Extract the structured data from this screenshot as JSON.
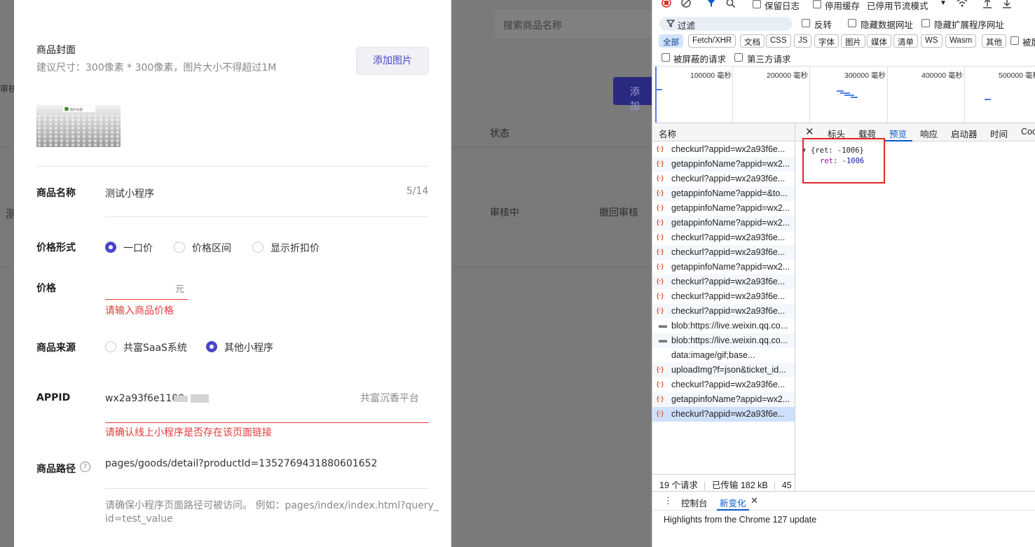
{
  "background_page": {
    "search_placeholder": "搜索商品名称",
    "left_fragment": "审核中",
    "add_button_label": "添加",
    "column_status": "状态",
    "row_fragment": "测",
    "row_status": "审核中",
    "row_action": "撤回审核"
  },
  "form": {
    "cover_label": "商品封面",
    "cover_hint": "建议尺寸：300像素 * 300像素，图片大小不得超过1M",
    "add_image_label": "添加图片",
    "cover_image_caption": "图片标题",
    "name_label": "商品名称",
    "name_value": "测试小程序",
    "name_counter": "5/14",
    "price_type_label": "价格形式",
    "price_type_options": [
      "一口价",
      "价格区间",
      "显示折扣价"
    ],
    "price_type_selected": "一口价",
    "price_label": "价格",
    "price_unit": "元",
    "price_error": "请输入商品价格",
    "source_label": "商品来源",
    "source_options": [
      "共富SaaS系统",
      "其他小程序"
    ],
    "source_selected": "其他小程序",
    "appid_label": "APPID",
    "appid_value": "wx2a93f6e1100",
    "appid_platform": "共富沉香平台",
    "appid_error": "请确认线上小程序是否存在该页面链接",
    "path_label": "商品路径",
    "path_help_icon": "?",
    "path_value": "pages/goods/detail?productId=1352769431880601652",
    "path_hint_line1": "请确保小程序页面路径可被访问。 例如：pages/index/index.html?query_",
    "path_hint_line2": "id=test_value"
  },
  "devtools": {
    "toolbar": {
      "preserve_log": "保留日志",
      "disable_cache": "停用缓存",
      "throttle": "已停用节流模式"
    },
    "filter": {
      "placeholder": "过滤",
      "invert": "反转",
      "hide_data_urls": "隐藏数据网址",
      "hide_extension_urls": "隐藏扩展程序网址",
      "blocked_requests": "被屏蔽的请求",
      "third_party": "第三方请求",
      "blocked_cookies_fragment": "被屏"
    },
    "type_chips": [
      "全部",
      "Fetch/XHR",
      "文档",
      "CSS",
      "JS",
      "字体",
      "图片",
      "媒体",
      "清单",
      "WS",
      "Wasm",
      "其他"
    ],
    "selected_chip": "全部",
    "timeline_labels": [
      "100000 毫秒",
      "200000 毫秒",
      "300000 毫秒",
      "400000 毫秒",
      "500000 毫秒"
    ],
    "name_column": "名称",
    "requests": [
      {
        "name": "checkurl?appid=wx2a93f6e...",
        "icon": "xhr-icon"
      },
      {
        "name": "getappinfoName?appid=wx2...",
        "icon": "xhr-icon"
      },
      {
        "name": "checkurl?appid=wx2a93f6e...",
        "icon": "xhr-icon"
      },
      {
        "name": "getappinfoName?appid=&to...",
        "icon": "xhr-icon"
      },
      {
        "name": "getappinfoName?appid=wx2...",
        "icon": "xhr-icon"
      },
      {
        "name": "getappinfoName?appid=wx2...",
        "icon": "xhr-icon"
      },
      {
        "name": "checkurl?appid=wx2a93f6e...",
        "icon": "xhr-icon"
      },
      {
        "name": "checkurl?appid=wx2a93f6e...",
        "icon": "xhr-icon"
      },
      {
        "name": "getappinfoName?appid=wx2...",
        "icon": "xhr-icon"
      },
      {
        "name": "checkurl?appid=wx2a93f6e...",
        "icon": "xhr-icon"
      },
      {
        "name": "checkurl?appid=wx2a93f6e...",
        "icon": "xhr-icon"
      },
      {
        "name": "checkurl?appid=wx2a93f6e...",
        "icon": "xhr-icon"
      },
      {
        "name": "blob:https://live.weixin.qq.co...",
        "icon": "document-icon"
      },
      {
        "name": "blob:https://live.weixin.qq.co...",
        "icon": "document-icon"
      },
      {
        "name": "data:image/gif;base...",
        "icon": "image-icon"
      },
      {
        "name": "uploadImg?f=json&ticket_id...",
        "icon": "xhr-icon"
      },
      {
        "name": "checkurl?appid=wx2a93f6e...",
        "icon": "xhr-icon"
      },
      {
        "name": "getappinfoName?appid=wx2...",
        "icon": "xhr-icon"
      },
      {
        "name": "checkurl?appid=wx2a93f6e...",
        "icon": "xhr-icon"
      }
    ],
    "selected_request_index": 18,
    "status_bar": {
      "requests": "19 个请求",
      "transferred": "已传输 182 kB",
      "more": "45"
    },
    "detail_tabs": [
      "标头",
      "载荷",
      "预览",
      "响应",
      "启动器",
      "时间",
      "Coo"
    ],
    "selected_detail_tab": "预览",
    "preview": {
      "summary": "{ret: -1006}",
      "key": "ret",
      "value": "-1006"
    },
    "drawer": {
      "console_tab": "控制台",
      "whats_new_tab": "新变化",
      "whats_new_text": "Highlights from the Chrome 127 update"
    }
  }
}
